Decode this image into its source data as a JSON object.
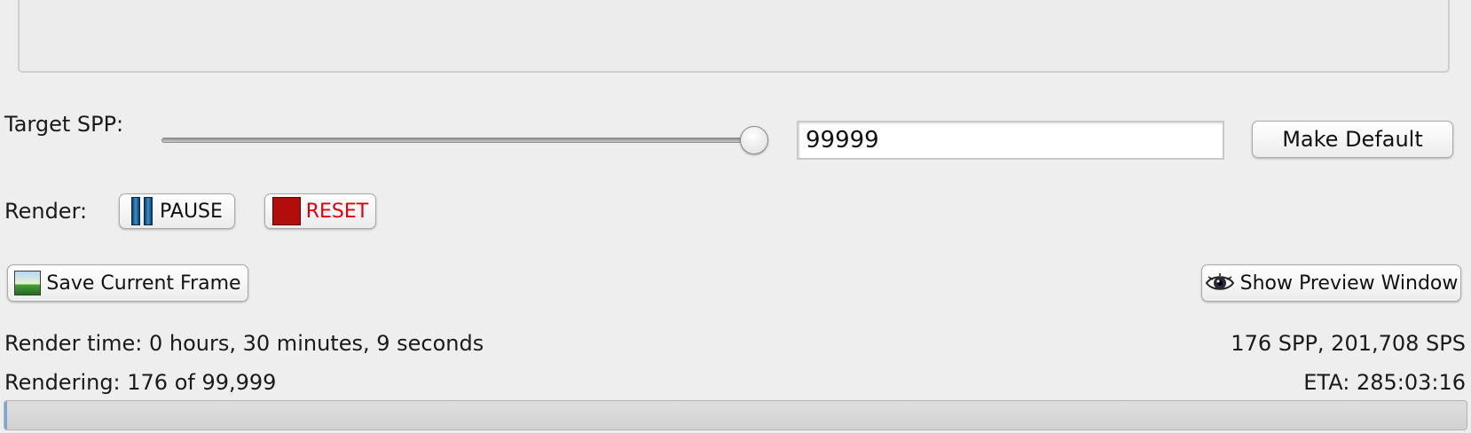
{
  "target_spp": {
    "label": "Target SPP:",
    "slider_value": 99999,
    "slider_fraction": 1.0,
    "input_value": "99999",
    "make_default_label": "Make Default"
  },
  "render": {
    "label": "Render:",
    "pause_label": "PAUSE",
    "reset_label": "RESET",
    "reset_color": "#e0000a"
  },
  "actions": {
    "save_frame_label": "Save Current Frame",
    "show_preview_label": "Show Preview Window"
  },
  "status": {
    "render_time": "Render time: 0 hours, 30 minutes, 9 seconds",
    "speed": "176 SPP, 201,708 SPS",
    "rendering": "Rendering: 176 of 99,999",
    "eta": "ETA: 285:03:16",
    "progress_fraction": 0.00176
  },
  "icons": {
    "pause": "pause-icon",
    "reset": "stop-icon",
    "save": "picture-icon",
    "preview": "eye-icon"
  }
}
